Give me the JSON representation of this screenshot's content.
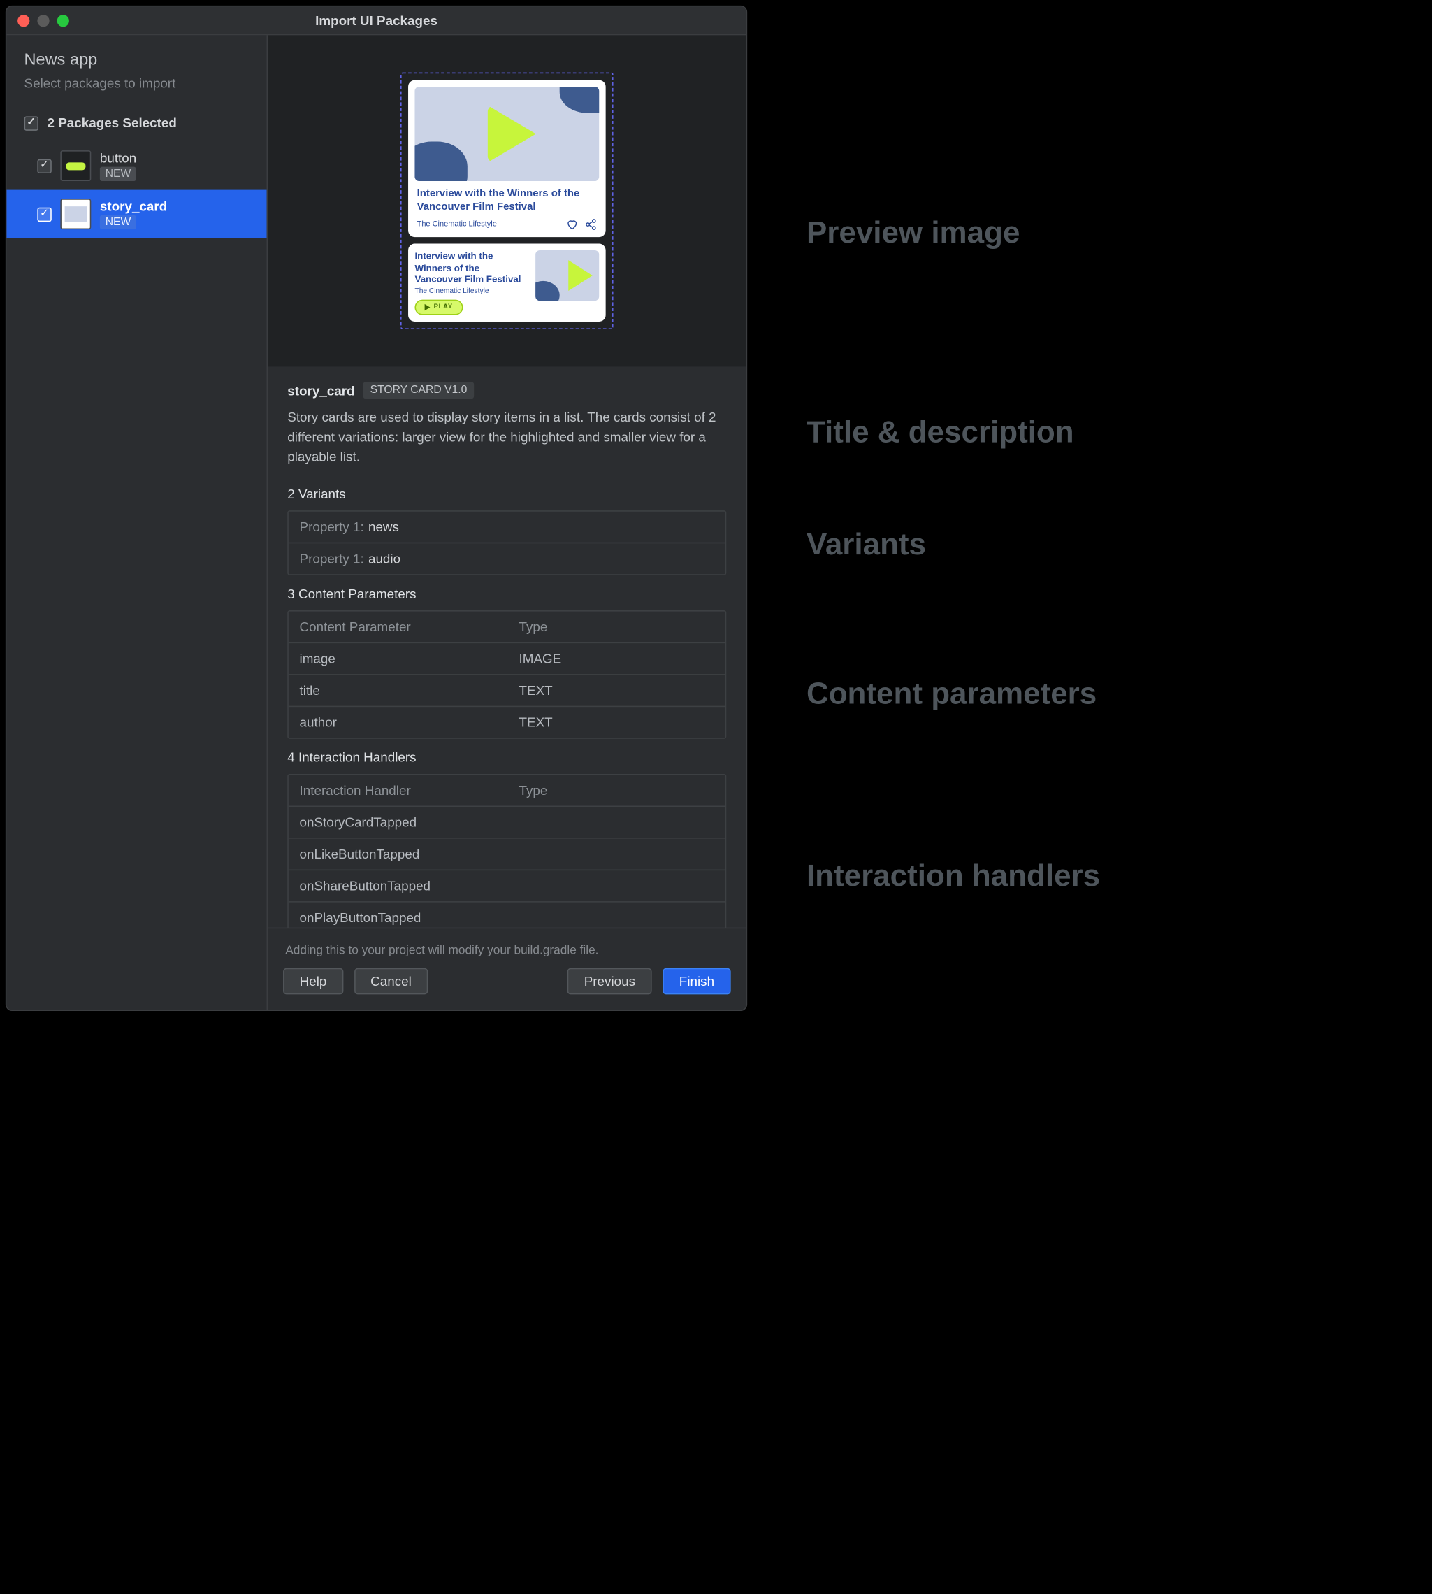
{
  "window": {
    "title": "Import UI Packages"
  },
  "sidebar": {
    "project": "News app",
    "subtitle": "Select packages to import",
    "selected_label": "2 Packages Selected",
    "items": [
      {
        "name": "button",
        "badge": "NEW"
      },
      {
        "name": "story_card",
        "badge": "NEW"
      }
    ]
  },
  "preview": {
    "card_large": {
      "title": "Interview with the Winners of the Vancouver Film Festival",
      "author": "The Cinematic Lifestyle"
    },
    "card_small": {
      "title": "Interview with the Winners of the Vancouver Film Festival",
      "author": "The Cinematic Lifestyle",
      "play_label": "PLAY"
    }
  },
  "detail": {
    "name": "story_card",
    "version_badge": "STORY CARD V1.0",
    "description": "Story cards are used to display story items in a list. The cards consist of 2 different variations: larger view for the highlighted and smaller view for a playable list.",
    "variants": {
      "heading": "2 Variants",
      "rows": [
        {
          "label": "Property 1:",
          "value": "news"
        },
        {
          "label": "Property 1:",
          "value": "audio"
        }
      ]
    },
    "content_params": {
      "heading": "3 Content Parameters",
      "header": {
        "c1": "Content Parameter",
        "c2": "Type"
      },
      "rows": [
        {
          "name": "image",
          "type": "IMAGE"
        },
        {
          "name": "title",
          "type": "TEXT"
        },
        {
          "name": "author",
          "type": "TEXT"
        }
      ]
    },
    "handlers": {
      "heading": "4 Interaction Handlers",
      "header": {
        "c1": "Interaction Handler",
        "c2": "Type"
      },
      "rows": [
        {
          "name": "onStoryCardTapped"
        },
        {
          "name": "onLikeButtonTapped"
        },
        {
          "name": "onShareButtonTapped"
        },
        {
          "name": "onPlayButtonTapped"
        }
      ]
    }
  },
  "footer": {
    "note": "Adding this to your project will modify your build.gradle file.",
    "help": "Help",
    "cancel": "Cancel",
    "previous": "Previous",
    "finish": "Finish"
  },
  "annotations": {
    "preview": "Preview image",
    "title_desc": "Title & description",
    "variants": "Variants",
    "content_params": "Content parameters",
    "handlers": "Interaction handlers"
  }
}
